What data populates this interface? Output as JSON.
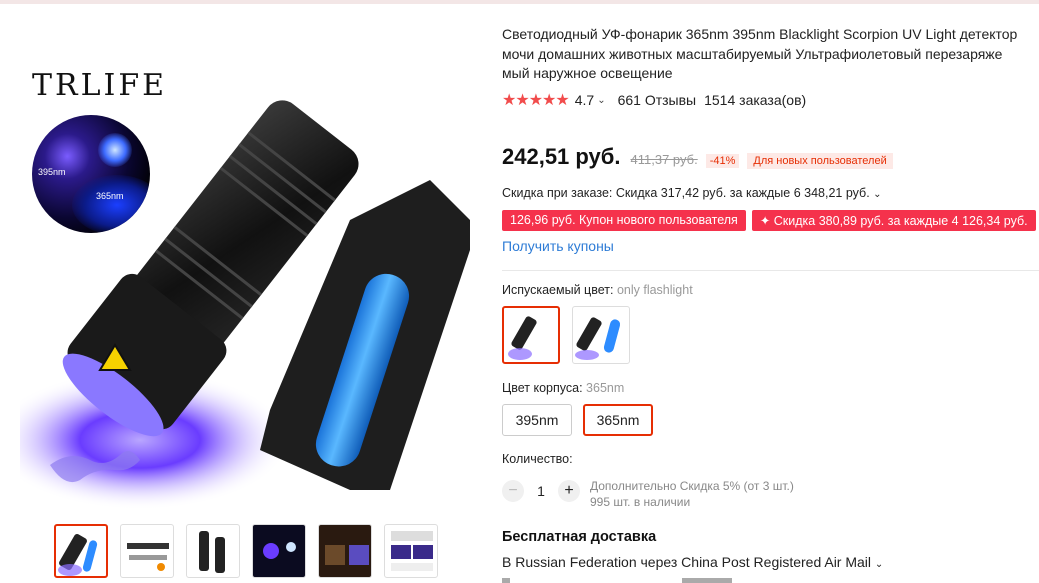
{
  "product": {
    "title_lines": [
      "Светодиодный УФ-фонарик 365nm 395nm Blacklight Scorpion UV Light детектор",
      "мочи домашних животных масштабируемый Ультрафиолетовый перезаряже",
      "мый наружное освещение"
    ],
    "rating": "4.7",
    "stars": "★★★★★",
    "reviews": "661 Отзывы",
    "orders": "1514 заказа(ов)"
  },
  "gallery": {
    "brand": "TRLIFE",
    "uv_labels": [
      "395nm",
      "365nm"
    ],
    "thumbnail_count": 6
  },
  "price": {
    "current": "242,51 руб.",
    "original": "411,37 руб.",
    "discount": "-41%",
    "new_user_badge": "Для новых пользователей"
  },
  "promotions": {
    "order_discount": "Скидка при заказе: Скидка 317,42 руб. за каждые 6 348,21 руб.",
    "coupons": [
      "126,96 руб. Купон нового пользователя",
      "✦ Скидка 380,89 руб. за каждые 4 126,34 руб."
    ],
    "get_coupons": "Получить купоны"
  },
  "options": {
    "color_label": "Испускаемый цвет:",
    "color_selected": "only flashlight",
    "body_label": "Цвет корпуса:",
    "body_selected": "365nm",
    "sizes": [
      "395nm",
      "365nm"
    ],
    "active_size_index": 1
  },
  "quantity": {
    "label": "Количество:",
    "value": "1",
    "minus": "−",
    "plus": "+",
    "note_line1": "Дополнительно Скидка 5% (от 3 шт.)",
    "note_line2": "995 шт. в наличии"
  },
  "shipping": {
    "title": "Бесплатная доставка",
    "line": "В Russian Federation через China Post Registered Air Mail"
  },
  "colors": {
    "accent": "#e62e04",
    "star": "#f14c4c",
    "coupon": "#f5324c",
    "link": "#2e7cd6"
  }
}
